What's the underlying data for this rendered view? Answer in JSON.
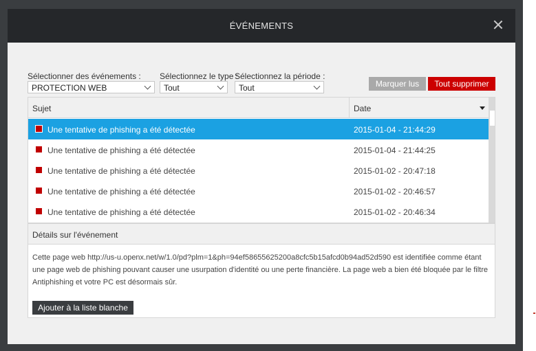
{
  "dialog": {
    "title": "ÉVÉNEMENTS"
  },
  "filters": {
    "events": {
      "label": "Sélectionner des événements :",
      "value": "PROTECTION WEB"
    },
    "type": {
      "label": "Sélectionnez le type :",
      "value": "Tout"
    },
    "period": {
      "label": "Sélectionnez la période :",
      "value": "Tout"
    }
  },
  "actions": {
    "mark_read": "Marquer lus",
    "delete_all": "Tout supprimer"
  },
  "table": {
    "columns": {
      "subject": "Sujet",
      "date": "Date"
    },
    "rows": [
      {
        "subject": "Une tentative de phishing a été détectée",
        "date": "2015-01-04 - 21:44:29"
      },
      {
        "subject": "Une tentative de phishing a été détectée",
        "date": "2015-01-04 - 21:44:25"
      },
      {
        "subject": "Une tentative de phishing a été détectée",
        "date": "2015-01-02 - 20:47:18"
      },
      {
        "subject": "Une tentative de phishing a été détectée",
        "date": "2015-01-02 - 20:46:57"
      },
      {
        "subject": "Une tentative de phishing a été détectée",
        "date": "2015-01-02 - 20:46:34"
      }
    ]
  },
  "details": {
    "title": "Détails sur l'événement",
    "text": "Cette page web http://us-u.openx.net/w/1.0/pd?plm=1&ph=94ef58655625200a8cfc5b15afcd0b94ad52d590 est identifiée comme étant une page web de phishing pouvant causer une usurpation d'identité ou une perte financière. La page web a bien été bloquée par le filtre Antiphishing et votre PC est désormais sûr.",
    "whitelist_button": "Ajouter à la liste blanche"
  },
  "colors": {
    "accent": "#1ba1e2",
    "danger": "#cc0000",
    "titlebar": "#25272a"
  }
}
